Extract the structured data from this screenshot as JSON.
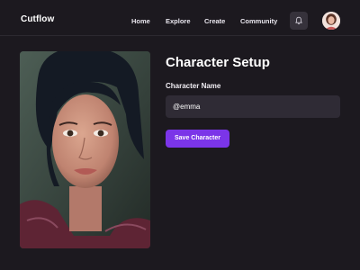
{
  "app": {
    "name": "Cutflow"
  },
  "nav": {
    "items": [
      {
        "label": "Home"
      },
      {
        "label": "Explore"
      },
      {
        "label": "Create"
      },
      {
        "label": "Community"
      }
    ],
    "notifications_icon": "bell-icon",
    "avatar_icon": "user-avatar"
  },
  "main": {
    "title": "Character Setup",
    "name_label": "Character Name",
    "name_value": "@emma",
    "save_label": "Save Character"
  },
  "colors": {
    "background": "#1c191f",
    "input_bg": "#2f2b35",
    "accent": "#7b35e8"
  }
}
